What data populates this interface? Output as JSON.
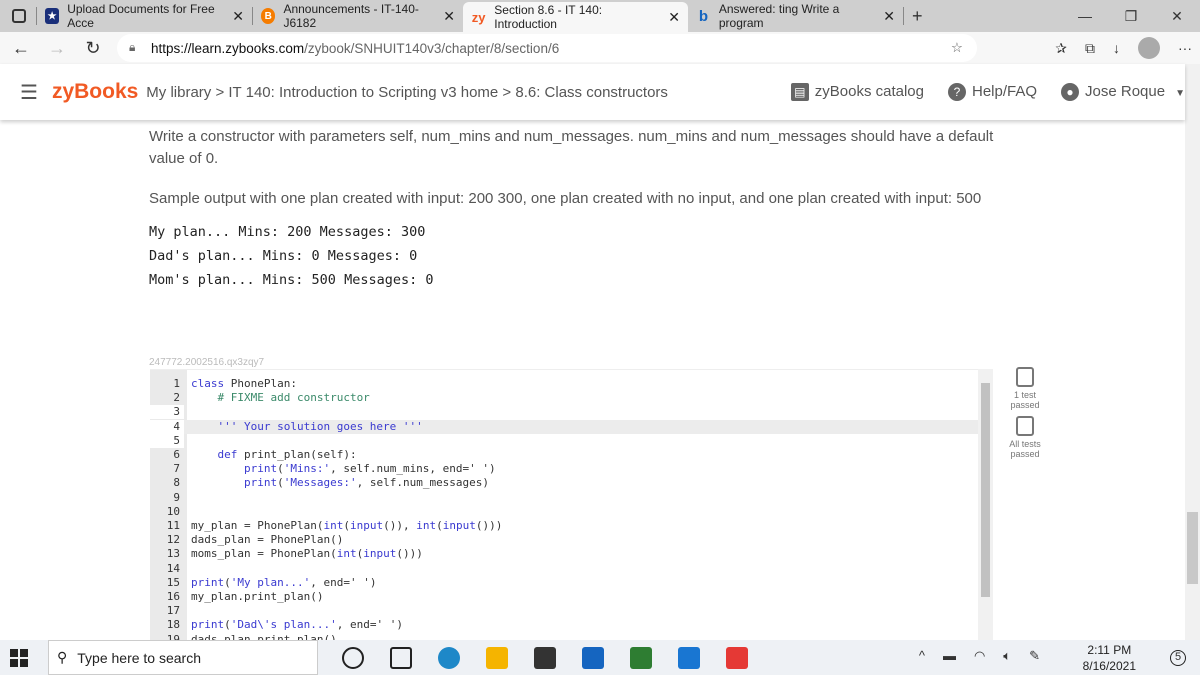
{
  "browser": {
    "tabs": [
      {
        "title": "Upload Documents for Free Acce",
        "icon": "shield-star-icon",
        "active": false
      },
      {
        "title": "Announcements - IT-140-J6182",
        "icon": "brightspace-icon",
        "active": false
      },
      {
        "title": "Section 8.6 - IT 140: Introduction",
        "icon": "zybooks-icon",
        "active": true
      },
      {
        "title": "Answered: ting Write a program",
        "icon": "bartleby-icon",
        "active": false
      }
    ],
    "new_tab": "+",
    "url_domain": "https://learn.zybooks.com",
    "url_path": "/zybook/SNHUIT140v3/chapter/8/section/6"
  },
  "header": {
    "logo": "zyBooks",
    "breadcrumb": "My library > IT 140: Introduction to Scripting v3 home > 8.6: Class constructors",
    "catalog": "zyBooks catalog",
    "help": "Help/FAQ",
    "user": "Jose Roque"
  },
  "main": {
    "instructions": "Write a constructor with parameters self, num_mins and num_messages. num_mins and num_messages should have a default value of 0.",
    "sample_intro": "Sample output with one plan created with input: 200 300, one plan created with no input, and one plan created with input: 500",
    "sample_output": [
      "My plan... Mins: 200 Messages: 300",
      "Dad's plan... Mins: 0 Messages: 0",
      "Mom's plan... Mins: 500 Messages: 0"
    ],
    "challenge_id": "247772.2002516.qx3zqy7",
    "code_lines": [
      [
        [
          "class",
          "kw"
        ],
        [
          " PhonePlan:",
          ""
        ]
      ],
      [
        [
          "    # FIXME add constructor",
          "cm"
        ]
      ],
      [],
      [
        [
          "    ''' Your solution goes here '''",
          "st"
        ]
      ],
      [],
      [
        [
          "    ",
          ""
        ],
        [
          "def",
          "kw"
        ],
        [
          " print_plan(self):",
          ""
        ]
      ],
      [
        [
          "        ",
          ""
        ],
        [
          "print",
          "kw"
        ],
        [
          "(",
          ""
        ],
        [
          "'Mins:'",
          "st"
        ],
        [
          ", self.num_mins, end=' ')",
          ""
        ]
      ],
      [
        [
          "        ",
          ""
        ],
        [
          "print",
          "kw"
        ],
        [
          "(",
          ""
        ],
        [
          "'Messages:'",
          "st"
        ],
        [
          ", self.num_messages)",
          ""
        ]
      ],
      [],
      [],
      [
        [
          "my_plan = PhonePlan(",
          ""
        ],
        [
          "int",
          "kw"
        ],
        [
          "(",
          ""
        ],
        [
          "input",
          "kw"
        ],
        [
          "()), ",
          ""
        ],
        [
          "int",
          "kw"
        ],
        [
          "(",
          ""
        ],
        [
          "input",
          "kw"
        ],
        [
          "()))",
          ""
        ]
      ],
      [
        [
          "dads_plan = PhonePlan()",
          ""
        ]
      ],
      [
        [
          "moms_plan = PhonePlan(",
          ""
        ],
        [
          "int",
          "kw"
        ],
        [
          "(",
          ""
        ],
        [
          "input",
          "kw"
        ],
        [
          "()))",
          ""
        ]
      ],
      [],
      [
        [
          "print",
          "kw"
        ],
        [
          "(",
          ""
        ],
        [
          "'My plan...'",
          "st"
        ],
        [
          ", end=' ')",
          ""
        ]
      ],
      [
        [
          "my_plan.print_plan()",
          ""
        ]
      ],
      [],
      [
        [
          "print",
          "kw"
        ],
        [
          "(",
          ""
        ],
        [
          "'Dad\\'s plan...'",
          "st"
        ],
        [
          ", end=' ')",
          ""
        ]
      ],
      [
        [
          "dads_plan.print_plan()",
          ""
        ]
      ]
    ],
    "tests": [
      {
        "label": "1 test passed"
      },
      {
        "label": "All tests passed"
      }
    ]
  },
  "taskbar": {
    "search_placeholder": "Type here to search",
    "time": "2:11 PM",
    "date": "8/16/2021",
    "notifications": "5"
  }
}
